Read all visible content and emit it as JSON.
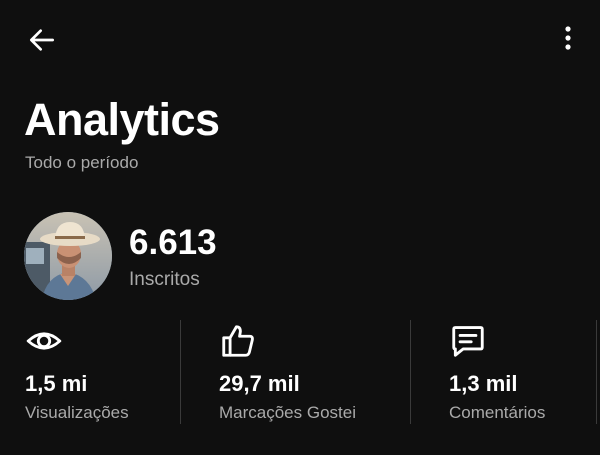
{
  "header": {
    "back_icon": "arrow-left-icon",
    "menu_icon": "more-vertical-icon"
  },
  "page": {
    "title": "Analytics",
    "period": "Todo o período"
  },
  "channel": {
    "subscriber_count": "6.613",
    "subscriber_label": "Inscritos",
    "avatar": "channel-avatar-cowboy-hat"
  },
  "metrics": [
    {
      "icon": "eye-icon",
      "value": "1,5 mi",
      "label": "Visualizações"
    },
    {
      "icon": "thumbs-up-icon",
      "value": "29,7 mil",
      "label": "Marcações Gostei"
    },
    {
      "icon": "comment-icon",
      "value": "1,3 mil",
      "label": "Comentários"
    }
  ],
  "colors": {
    "background": "#0f0f0f",
    "text_primary": "#ffffff",
    "text_secondary": "#aaaaaa",
    "divider": "#3a3a3a"
  }
}
